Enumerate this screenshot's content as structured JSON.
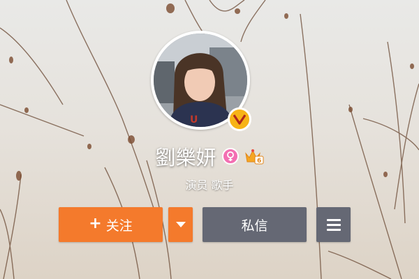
{
  "profile": {
    "name": "劉樂妍",
    "tagline": "演员 歌手",
    "verified_icon": "verified-v-icon",
    "gender_icon": "female-icon",
    "level_icon": "level-crown-icon",
    "level_number": "6"
  },
  "actions": {
    "follow_label": "关注",
    "follow_plus": "+",
    "message_label": "私信"
  },
  "colors": {
    "follow": "#f47a2c",
    "secondary": "#656874",
    "verified": "#f7b316",
    "female": "#f36fb2"
  }
}
